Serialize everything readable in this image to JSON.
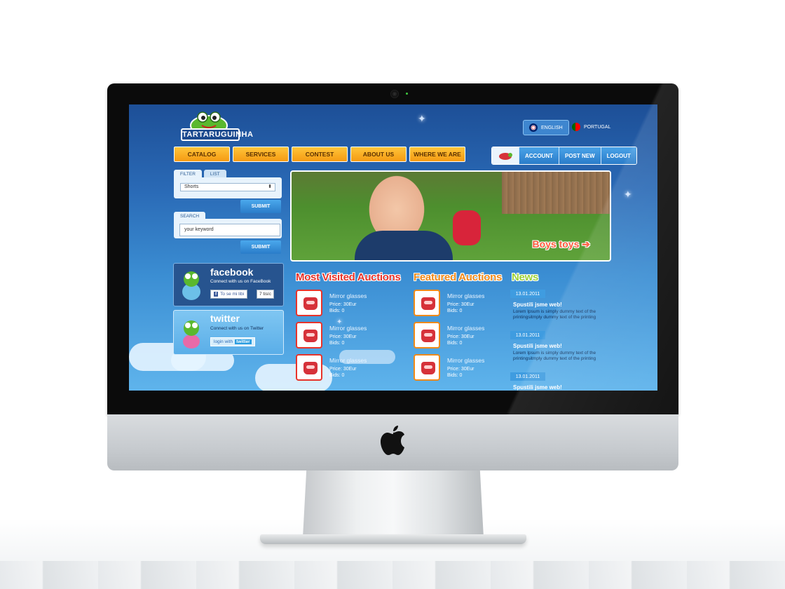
{
  "site": {
    "logo_text": "TARTARUGUINHA"
  },
  "languages": [
    {
      "label": "ENGLISH",
      "active": true
    },
    {
      "label": "PORTUGAL",
      "active": false
    }
  ],
  "nav": [
    "CATALOG",
    "SERVICES",
    "CONTEST",
    "ABOUT US",
    "WHERE WE ARE"
  ],
  "account": {
    "account_label": "ACCOUNT",
    "post_new_label": "POST NEW",
    "logout_label": "LOGOUT"
  },
  "filter": {
    "tab_filter": "FILTER",
    "tab_list": "LIST",
    "selected": "Shorts",
    "submit": "SUBMIT"
  },
  "search": {
    "label": "SEARCH",
    "value": "your keyword",
    "submit": "SUBMIT"
  },
  "facebook": {
    "title": "facebook",
    "subtitle": "Connect with us on FaceBook",
    "like_label": "To se mi libi",
    "count": "7 tisíc"
  },
  "twitter": {
    "title": "twitter",
    "subtitle": "Connect with us on Twitter",
    "login_label": "login with",
    "login_brand": "twitter"
  },
  "hero": {
    "caption": "Boys toys"
  },
  "most_visited": {
    "title": "Most Visited Auctions",
    "items": [
      {
        "name": "Mirror glasses",
        "price": "Price: 30Eur",
        "bids": "Bids: 0"
      },
      {
        "name": "Mirror glasses",
        "price": "Price: 30Eur",
        "bids": "Bids: 0"
      },
      {
        "name": "Mirror glasses",
        "price": "Price: 30Eur",
        "bids": "Bids: 0"
      }
    ]
  },
  "featured": {
    "title": "Featured Auctions",
    "items": [
      {
        "name": "Mirror glasses",
        "price": "Price: 30Eur",
        "bids": "Bids: 0"
      },
      {
        "name": "Mirror glasses",
        "price": "Price: 30Eur",
        "bids": "Bids: 0"
      },
      {
        "name": "Mirror glasses",
        "price": "Price: 30Eur",
        "bids": "Bids: 0"
      }
    ]
  },
  "news": {
    "title": "News",
    "items": [
      {
        "date": "13.01.2011",
        "title": "Spustili jsme web!",
        "body": "Lorem Ipsum is simply dummy text of the printingsitmply dummy text of the printing"
      },
      {
        "date": "13.01.2011",
        "title": "Spustili jsme web!",
        "body": "Lorem Ipsum is simply dummy text of the printingsitmply dummy text of the printing"
      },
      {
        "date": "13.01.2011",
        "title": "Spustili jsme web!",
        "body": ""
      }
    ]
  },
  "colors": {
    "nav_orange": "#f59a12",
    "most_visited_red": "#e8332a",
    "featured_orange": "#f08a1a",
    "news_green": "#9fd23a",
    "page_blue": "#2a6ab6"
  }
}
